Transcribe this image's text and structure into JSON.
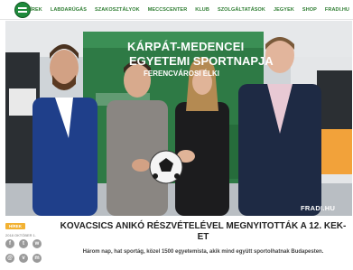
{
  "header": {
    "logo_name": "ftc-logo",
    "nav_items": [
      "HÍREK",
      "LABDARÚGÁS",
      "SZAKOSZTÁLYOK",
      "MECCSCENTER",
      "KLUB",
      "SZOLGÁLTATÁSOK",
      "JEGYEK",
      "SHOP",
      "FRADI.HU"
    ]
  },
  "photo": {
    "banner_line1": "KÁRPÁT-MEDENCEI",
    "banner_line2": "EGYETEMI SPORTNAPJA",
    "banner_line3": "FERENCVÁROSI ÉLKI",
    "watermark": "FRADI.HU"
  },
  "article": {
    "badge": "HÍREK",
    "date": "2018 OKTÓBER 1.",
    "headline": "KOVACSICS ANIKÓ RÉSZVÉTELÉVEL MEGNYITOTTÁK A 12. KEK-ET",
    "lead": "Három nap, hat sportág, közel 1500 egyetemista, akik mind együtt sportolhatnak Budapesten."
  },
  "social": {
    "icons": [
      "facebook-icon",
      "twitter-icon",
      "whatsapp-icon",
      "email-icon",
      "viber-icon",
      "messenger-icon"
    ]
  },
  "colors": {
    "brand_green": "#1f8a3c",
    "badge_orange": "#f2b233",
    "banner_green": "#2e7a45"
  }
}
